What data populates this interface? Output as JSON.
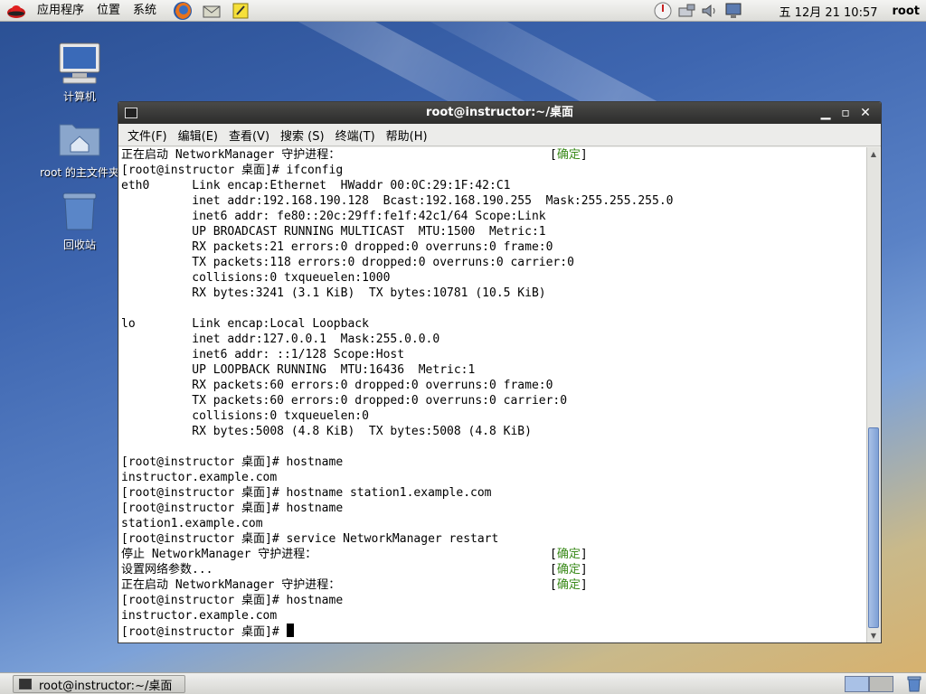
{
  "top_panel": {
    "menus": [
      "应用程序",
      "位置",
      "系统"
    ],
    "launchers": [
      "firefox-icon",
      "mail-icon",
      "notes-icon"
    ],
    "tray_icons": [
      "update-icon",
      "network-icon",
      "volume-icon",
      "display-icon"
    ],
    "clock": "五 12月 21 10:57",
    "user": "root"
  },
  "desktop_icons": [
    {
      "label": "计算机",
      "icon": "computer-icon"
    },
    {
      "label": "root 的主文件夹",
      "icon": "home-folder-icon"
    },
    {
      "label": "回收站",
      "icon": "trash-icon"
    }
  ],
  "window": {
    "title": "root@instructor:~/桌面",
    "menubar": [
      "文件(F)",
      "编辑(E)",
      "查看(V)",
      "搜索 (S)",
      "终端(T)",
      "帮助(H)"
    ]
  },
  "terminal": {
    "lines": [
      "正在启动 NetworkManager 守护进程：",
      "[root@instructor 桌面]# ifconfig",
      "eth0      Link encap:Ethernet  HWaddr 00:0C:29:1F:42:C1",
      "          inet addr:192.168.190.128  Bcast:192.168.190.255  Mask:255.255.255.0",
      "          inet6 addr: fe80::20c:29ff:fe1f:42c1/64 Scope:Link",
      "          UP BROADCAST RUNNING MULTICAST  MTU:1500  Metric:1",
      "          RX packets:21 errors:0 dropped:0 overruns:0 frame:0",
      "          TX packets:118 errors:0 dropped:0 overruns:0 carrier:0",
      "          collisions:0 txqueuelen:1000",
      "          RX bytes:3241 (3.1 KiB)  TX bytes:10781 (10.5 KiB)",
      "",
      "lo        Link encap:Local Loopback",
      "          inet addr:127.0.0.1  Mask:255.0.0.0",
      "          inet6 addr: ::1/128 Scope:Host",
      "          UP LOOPBACK RUNNING  MTU:16436  Metric:1",
      "          RX packets:60 errors:0 dropped:0 overruns:0 frame:0",
      "          TX packets:60 errors:0 dropped:0 overruns:0 carrier:0",
      "          collisions:0 txqueuelen:0",
      "          RX bytes:5008 (4.8 KiB)  TX bytes:5008 (4.8 KiB)",
      "",
      "[root@instructor 桌面]# hostname",
      "instructor.example.com",
      "[root@instructor 桌面]# hostname station1.example.com",
      "[root@instructor 桌面]# hostname",
      "station1.example.com",
      "[root@instructor 桌面]# service NetworkManager restart",
      "停止 NetworkManager 守护进程：",
      "设置网络参数...",
      "正在启动 NetworkManager 守护进程：",
      "[root@instructor 桌面]# hostname",
      "instructor.example.com",
      "[root@instructor 桌面]# "
    ],
    "status_ok": "确定",
    "status_ok_lines": [
      0,
      26,
      27,
      28
    ],
    "ok_color": "#3a8a1a"
  },
  "taskbar": {
    "task_label": "root@instructor:~/桌面"
  }
}
